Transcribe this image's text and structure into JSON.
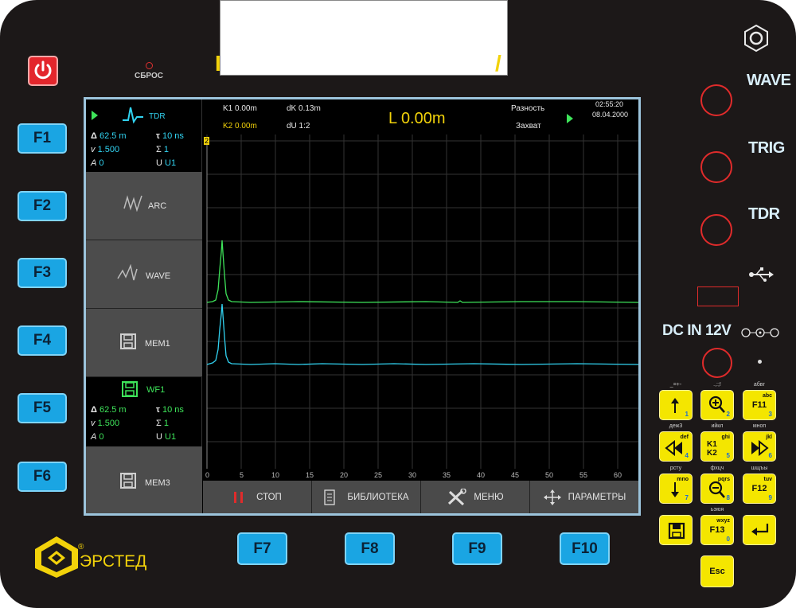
{
  "power_label": "power",
  "reset_label": "СБРОС",
  "title_fragment_left": "I",
  "title_fragment_right": "/",
  "fkeys_left": [
    "F1",
    "F2",
    "F3",
    "F4",
    "F5",
    "F6"
  ],
  "fkeys_bottom": [
    "F7",
    "F8",
    "F9",
    "F10"
  ],
  "screen": {
    "mode_name": "TDR",
    "k1": "K1 0.00m",
    "k2": "K2 0.00m",
    "dk": "dK 0.13m",
    "du": "dU 1:2",
    "distance": "L 0.00m",
    "mode_diff": "Разность",
    "mode_capture": "Захват",
    "time": "02:55:20",
    "date": "08.04.2000",
    "tdr_params": {
      "delta": "62.5 m",
      "tau": "10 ns",
      "v": "1.500",
      "sigma": "1",
      "a": "0",
      "u": "U1"
    },
    "wf1_params": {
      "delta": "62.5 m",
      "tau": "10 ns",
      "v": "1.500",
      "sigma": "1",
      "a": "0",
      "u": "U1"
    },
    "cursor_marker": "2",
    "panels": [
      "ARC",
      "WAVE",
      "MEM1",
      "WF1",
      "MEM3"
    ],
    "x_ticks": [
      "0",
      "5",
      "10",
      "15",
      "20",
      "25",
      "30",
      "35",
      "40",
      "45",
      "50",
      "55",
      "60"
    ],
    "bottom_buttons": [
      "СТОП",
      "БИБЛИОТЕКА",
      "МЕНЮ",
      "ПАРАМЕТРЫ"
    ],
    "colors": {
      "green_trace": "#3ee45a",
      "cyan_trace": "#31d3f1",
      "accent_yellow": "#f2d20a",
      "key_blue": "#1aa5e3"
    }
  },
  "right_side": {
    "labels": [
      "WAVE",
      "TRIG",
      "TDR"
    ],
    "dc_label": "DC IN 12V"
  },
  "keypad": {
    "k1": {
      "label": "↑",
      "sub": "abc",
      "num": "1",
      "top": "_=+-"
    },
    "k2": {
      "label": "⊕",
      "sub": "",
      "num": "2",
      "top": ".,:;!"
    },
    "k3": {
      "label": "F11",
      "sub": "abc",
      "num": "3",
      "top": "абвг"
    },
    "k4": {
      "label": "◁◁",
      "sub": "def",
      "num": "4",
      "top": "деж3"
    },
    "k5": {
      "label_a": "K1",
      "label_b": "K2",
      "sub": "ghi",
      "num": "5",
      "top": "ийкл"
    },
    "k6": {
      "label": "▷▷",
      "sub": "jkl",
      "num": "6",
      "top": "мноп"
    },
    "k7": {
      "label": "↓",
      "sub": "mno",
      "num": "7",
      "top": "рсту"
    },
    "k8": {
      "label": "⊖",
      "sub": "pqrs",
      "num": "8",
      "top": "фхцч"
    },
    "k9": {
      "label": "F12",
      "sub": "tuv",
      "num": "9",
      "top": "шщъы"
    },
    "k10": {
      "label": "save",
      "num": ""
    },
    "k11": {
      "label": "F13",
      "sub": "wxyz",
      "num": "0",
      "top": "ьэюя"
    },
    "k12": {
      "label": "↵",
      "num": ""
    },
    "esc": "Esc"
  },
  "brand": {
    "name": "ЭРСТЕД",
    "registered": "®"
  }
}
